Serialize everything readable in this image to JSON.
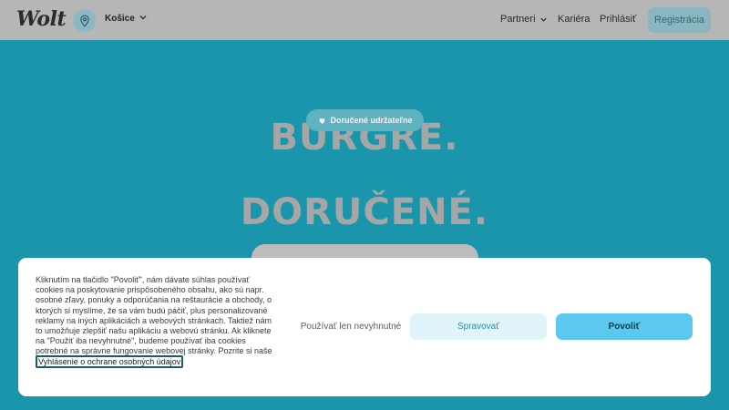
{
  "header": {
    "logo": "Wolt",
    "location": "Košice",
    "nav": {
      "partneri": "Partneri",
      "kariera": "Kariéra",
      "prihlasit": "Prihlásiť",
      "registracia": "Registrácia"
    }
  },
  "hero": {
    "pill": "Doručené udržateľne",
    "headline1": "BURGRE.",
    "headline2": "DORUČENÉ."
  },
  "cookie": {
    "text": "Kliknutím na tlačidlo \"Povoliť\", nám dávate súhlas používať cookies na poskytovanie prispôsobeného obsahu, ako sú napr. osobné zľavy, ponuky a odporúčania na reštaurácie a obchody, o ktorých si myslíme, že sa vám budú páčiť, plus personalizované reklamy na iných aplikáciách a webových stránkach. Taktiež nám to umožňuje zlepšiť našu aplikáciu a webovú stránku. Ak kliknete na \"Použiť iba nevyhnutné\", budeme používať iba cookies potrebné na správne fungovanie webovej stránky. Pozrite si naše ",
    "link": "Vyhlásenie o ochrane osobných údajov",
    "buttons": {
      "essential": "Používať len nevyhnutné",
      "manage": "Spravovať",
      "allow": "Povoliť"
    }
  }
}
